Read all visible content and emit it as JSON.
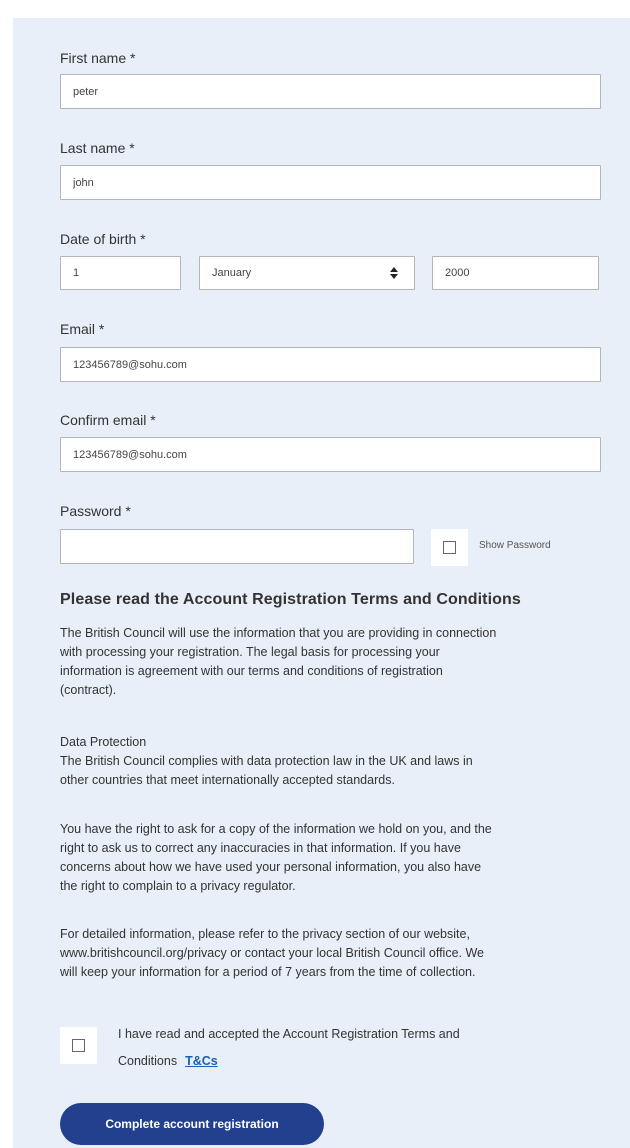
{
  "form": {
    "first_name": {
      "label": "First name *",
      "value": "peter"
    },
    "last_name": {
      "label": "Last name *",
      "value": "john"
    },
    "dob": {
      "label": "Date of birth *",
      "day": "1",
      "month": "January",
      "year": "2000"
    },
    "email": {
      "label": "Email *",
      "value": "123456789@sohu.com"
    },
    "confirm_email": {
      "label": "Confirm email *",
      "value": "123456789@sohu.com"
    },
    "password": {
      "label": "Password *",
      "value": "",
      "show_password_label": "Show Password"
    }
  },
  "terms": {
    "heading": "Please read the Account Registration Terms and Conditions",
    "paragraph1": [
      "The British Council will use the information that you are providing in connection",
      "with processing your registration. The legal basis for processing your",
      "information is agreement with our terms and conditions of registration",
      "(contract)."
    ],
    "paragraph2": [
      "Data Protection",
      "The British Council complies with data protection law in the UK and laws in",
      "other countries that meet internationally accepted standards."
    ],
    "paragraph3": [
      "You have the right to ask for a copy of the information we hold on you, and the",
      "right to ask us to correct any inaccuracies in that information. If you have",
      "concerns about how we have used your personal information, you also have",
      "the right to complain to a privacy regulator."
    ],
    "paragraph4": [
      "For detailed information, please refer to the privacy section of our website,",
      "www.britishcouncil.org/privacy or contact your local British Council office. We",
      "will keep your information for a period of 7 years from the time of collection."
    ],
    "accept_line1": "I have read and accepted the Account Registration Terms and",
    "accept_line2": "Conditions",
    "tcs_link": "T&Cs"
  },
  "submit": {
    "label": "Complete account registration"
  },
  "colors": {
    "panel_bg": "#e8eff8",
    "button_bg": "#23408e",
    "link": "#1a5fb4"
  }
}
